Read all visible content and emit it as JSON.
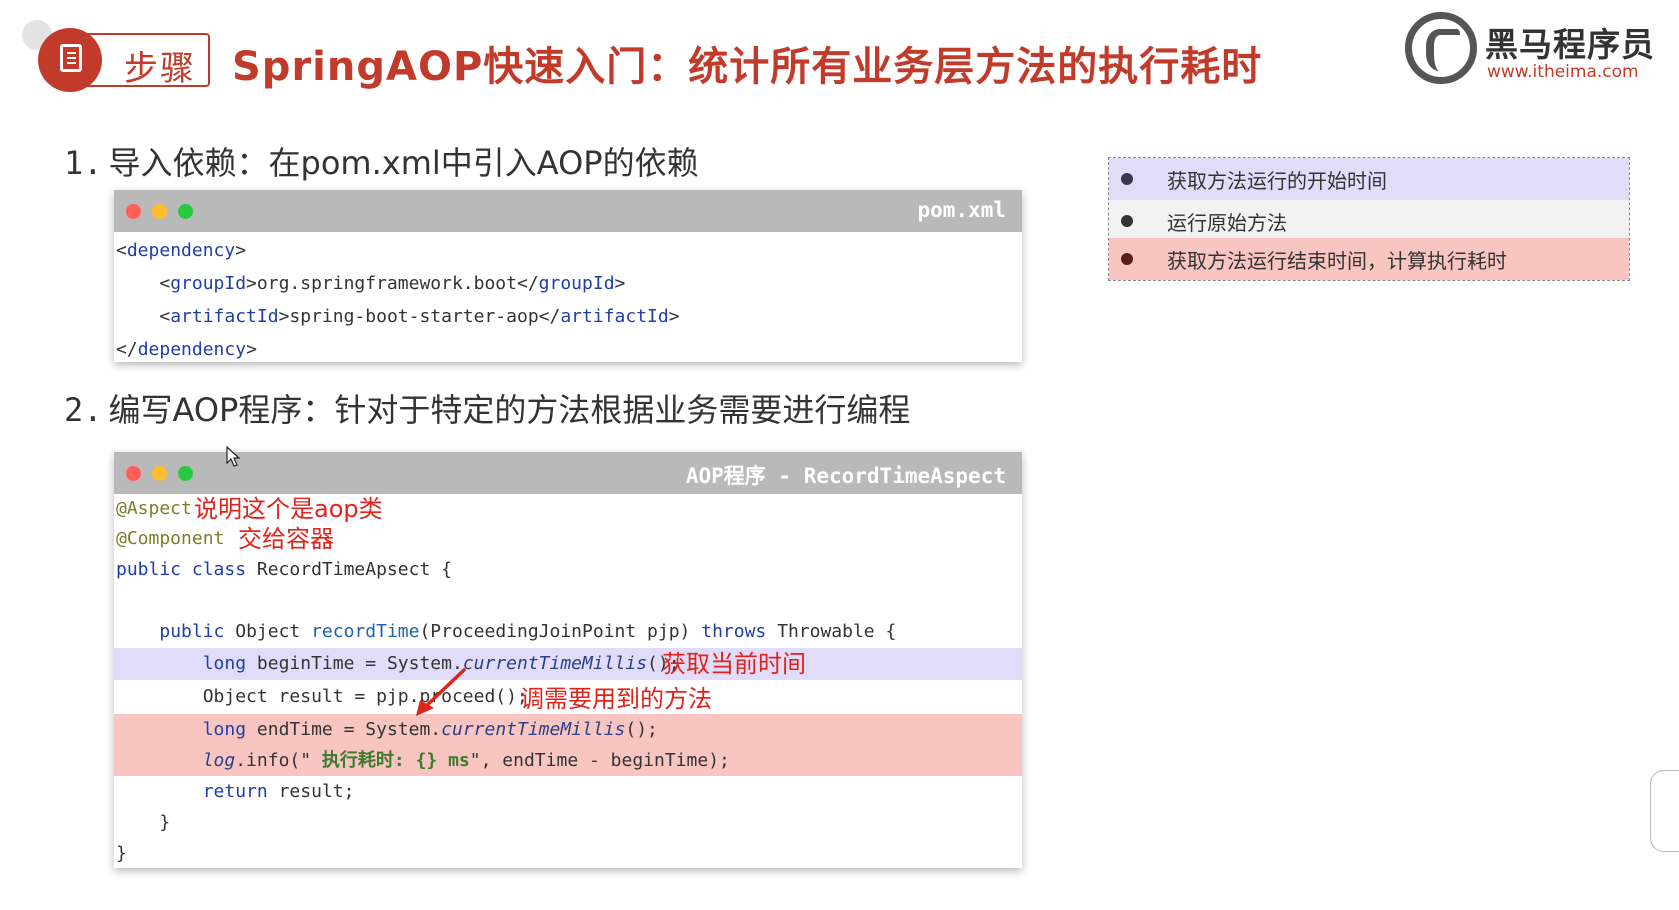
{
  "header": {
    "step_label": "步骤",
    "title": "SpringAOP快速入门：统计所有业务层方法的执行耗时"
  },
  "brand": {
    "name": "黑马程序员",
    "url": "www.itheima.com"
  },
  "sections": [
    {
      "number": "1.",
      "text": "导入依赖：在pom.xml中引入AOP的依赖"
    },
    {
      "number": "2.",
      "text": "编写AOP程序：针对于特定的方法根据业务需要进行编程"
    }
  ],
  "pom_window": {
    "title": "pom.xml",
    "lines": {
      "l1_open": "<",
      "l1_tag": "dependency",
      "l1_close": ">",
      "l2_tag": "groupId",
      "l2_value": "org.springframework.boot",
      "l3_tag": "artifactId",
      "l3_value": "spring-boot-starter-aop",
      "l4_tag": "dependency"
    }
  },
  "aop_window": {
    "title": "AOP程序 - RecordTimeAspect",
    "code": {
      "aspect": "@Aspect",
      "component": "@Component",
      "class_kw": "public class",
      "class_name": " RecordTimeApsect {",
      "method_public": "public",
      "method_ret": " Object ",
      "method_name": "recordTime",
      "method_params": "(ProceedingJoinPoint pjp) ",
      "method_throws": "throws",
      "method_throwable": " Throwable {",
      "l_begin_kw": "long",
      "l_begin_rest": " beginTime = System.",
      "l_begin_call": "currentTimeMillis",
      "l_begin_end": "();",
      "l_result": "Object result = pjp.proceed();",
      "l_end_kw": "long",
      "l_end_rest": " endTime = System.",
      "l_end_call": "currentTimeMillis",
      "l_end_end": "();",
      "l_log_obj": "log",
      "l_log_rest": ".info(\"",
      "l_log_str": " 执行耗时: {} ms",
      "l_log_end": "\", endTime - beginTime);",
      "l_return_kw": "return",
      "l_return_rest": " result;",
      "close_method": "}",
      "close_class": "}"
    },
    "notes": {
      "aspect_note": "说明这个是aop类",
      "component_note": "交给容器",
      "begin_note": "获取当前时间",
      "proceed_note": "调需要用到的方法"
    }
  },
  "legend": {
    "items": [
      {
        "label": "获取方法运行的开始时间",
        "bg": "#e2dcfb",
        "bullet": "#3b3550"
      },
      {
        "label": "运行原始方法",
        "bg": "#f2f2f2",
        "bullet": "#333333"
      },
      {
        "label": "获取方法运行结束时间，计算执行耗时",
        "bg": "#f9c5c0",
        "bullet": "#5a1f1b"
      }
    ]
  },
  "colors": {
    "accent": "#c23b2a",
    "note_red": "#e0241b"
  }
}
